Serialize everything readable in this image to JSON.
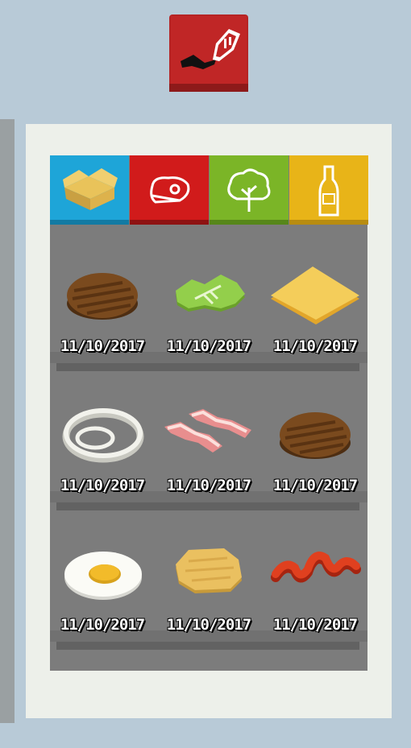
{
  "top_button": {
    "icon": "spatula-icon",
    "color": "#b52424"
  },
  "tabs": [
    {
      "name": "pantry",
      "icon": "box-icon",
      "color": "#1ea5d8"
    },
    {
      "name": "meat",
      "icon": "steak-icon",
      "color": "#d11b1b"
    },
    {
      "name": "vegetables",
      "icon": "tree-icon",
      "color": "#7bb527"
    },
    {
      "name": "condiments",
      "icon": "bottle-icon",
      "color": "#e8b418"
    }
  ],
  "items": [
    {
      "icon": "burger-patty-icon",
      "date": "11/10/2017"
    },
    {
      "icon": "lettuce-icon",
      "date": "11/10/2017"
    },
    {
      "icon": "cheese-slice-icon",
      "date": "11/10/2017"
    },
    {
      "icon": "onion-rings-icon",
      "date": "11/10/2017"
    },
    {
      "icon": "bacon-icon",
      "date": "11/10/2017"
    },
    {
      "icon": "burger-patty-icon",
      "date": "11/10/2017"
    },
    {
      "icon": "fried-egg-icon",
      "date": "11/10/2017"
    },
    {
      "icon": "hash-brown-icon",
      "date": "11/10/2017"
    },
    {
      "icon": "ketchup-icon",
      "date": "11/10/2017"
    }
  ]
}
